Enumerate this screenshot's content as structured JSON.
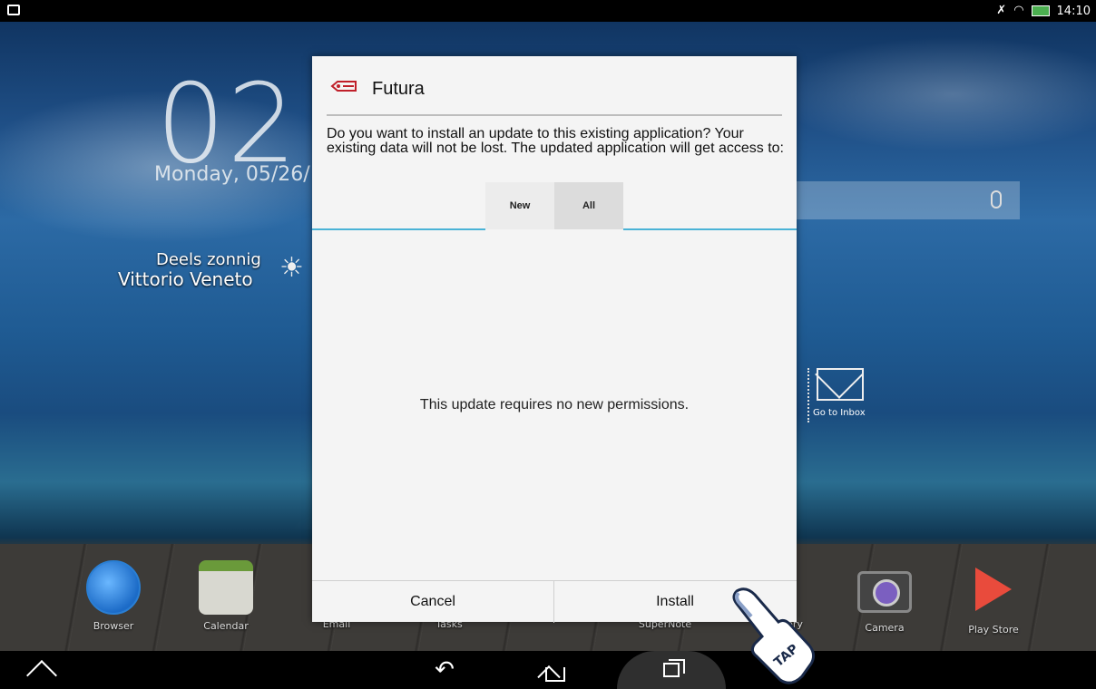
{
  "status_bar": {
    "time": "14:10"
  },
  "home": {
    "clock": "02:",
    "date": "Monday, 05/26/",
    "weather_condition": "Deels zonnig",
    "weather_city": "Vittorio Veneto",
    "inbox_label": "Go to Inbox"
  },
  "dock": [
    {
      "label": "Browser"
    },
    {
      "label": "Calendar"
    },
    {
      "label": "Email"
    },
    {
      "label": "Tasks"
    },
    {
      "label": "SuperNote"
    },
    {
      "label": "ery"
    },
    {
      "label": "Camera"
    },
    {
      "label": "Play Store"
    }
  ],
  "dialog": {
    "title": "Futura",
    "message": "Do you want to install an update to this existing application? Your existing data will not be lost. The updated application will get access to:",
    "tabs": [
      {
        "label": "New"
      },
      {
        "label": "All"
      }
    ],
    "no_permissions": "This update requires no new permissions.",
    "cancel_label": "Cancel",
    "install_label": "Install"
  },
  "tap_label": "TAP",
  "colors": {
    "accent": "#4ab3d6",
    "app_icon": "#c0202a"
  }
}
